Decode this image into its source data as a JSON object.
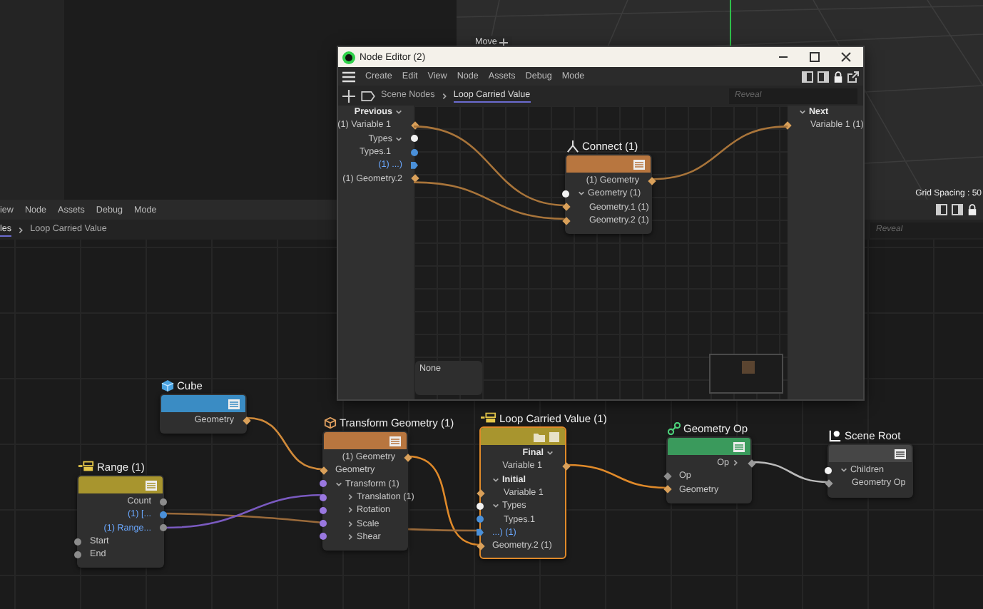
{
  "viewport": {
    "tool_label": "Move",
    "grid_spacing": "Grid Spacing : 50"
  },
  "background_editor": {
    "menu": [
      "iew",
      "Node",
      "Assets",
      "Debug",
      "Mode"
    ],
    "breadcrumb": [
      {
        "label": "les",
        "selected": true
      },
      {
        "label": "Loop Carried Value",
        "selected": false
      }
    ],
    "search": {
      "placeholder": "Reveal"
    }
  },
  "canvas": {
    "nodes": [
      {
        "title": "Cube",
        "color": "#3a8cc4",
        "selected": false,
        "outputs": [
          {
            "kind": "diamond",
            "label": "Geometry",
            "color": "#d9a05a",
            "highlighted": false
          }
        ]
      },
      {
        "title": "Range (1)",
        "color": "#a8952e",
        "selected": false,
        "outputs": [
          {
            "kind": "circle",
            "label": "Count",
            "color": "#8c8c8c",
            "highlighted": false
          },
          {
            "kind": "circle",
            "label": "(1) [...",
            "color": "#4a90d9",
            "highlighted": true
          },
          {
            "kind": "circle",
            "label": "(1) Range...",
            "color": "#8c8c8c",
            "highlighted": true
          }
        ],
        "inputs": [
          {
            "kind": "circle",
            "label": "Start",
            "color": "#8c8c8c",
            "highlighted": false
          },
          {
            "kind": "circle",
            "label": "End",
            "color": "#8c8c8c",
            "highlighted": false
          }
        ]
      },
      {
        "title": "Transform Geometry (1)",
        "color": "#b8763f",
        "selected": false,
        "outputs": [
          {
            "kind": "diamond",
            "label": "(1) Geometry",
            "color": "#d9a05a",
            "highlighted": false
          }
        ],
        "inputs": [
          {
            "kind": "diamond",
            "label": "Geometry",
            "color": "#d9a05a",
            "highlighted": false
          },
          {
            "kind": "circle",
            "label": "Transform (1)",
            "color": "#9a78e0",
            "highlighted": false,
            "expanded": true,
            "children": [
              {
                "kind": "circle",
                "label": "Translation (1)",
                "color": "#9a78e0",
                "highlighted": false,
                "expanded": false
              },
              {
                "kind": "circle",
                "label": "Rotation",
                "color": "#9a78e0",
                "highlighted": false,
                "expanded": false
              },
              {
                "kind": "circle",
                "label": "Scale",
                "color": "#9a78e0",
                "highlighted": false,
                "expanded": false
              },
              {
                "kind": "circle",
                "label": "Shear",
                "color": "#9a78e0",
                "highlighted": false,
                "expanded": false
              }
            ]
          }
        ]
      },
      {
        "title": "Loop Carried Value (1)",
        "color": "#a8952e",
        "selected": true,
        "outputs": [
          {
            "kind": "group",
            "label": "Final",
            "expanded": true,
            "children": [
              {
                "kind": "diamond",
                "label": "Variable 1",
                "color": "#d9a05a",
                "highlighted": false
              }
            ]
          }
        ],
        "inputs": [
          {
            "kind": "group",
            "label": "Initial",
            "expanded": true,
            "children": [
              {
                "kind": "diamond",
                "label": "Variable 1",
                "color": "#d9a05a",
                "highlighted": false
              }
            ]
          },
          {
            "kind": "circle",
            "label": "Types",
            "color": "#f2f2f2",
            "highlighted": false,
            "expanded": true,
            "children": [
              {
                "kind": "circle",
                "label": "Types.1",
                "color": "#4a90d9",
                "highlighted": false
              }
            ]
          },
          {
            "kind": "arrow",
            "label": "...) (1)",
            "color": "#4a90d9",
            "highlighted": true
          },
          {
            "kind": "diamond",
            "label": "Geometry.2 (1)",
            "color": "#d9a05a",
            "highlighted": false
          }
        ]
      },
      {
        "title": "Geometry Op",
        "color": "#3a9a5c",
        "selected": false,
        "outputs": [
          {
            "kind": "diamond",
            "label": "Op",
            "color": "#9a9a9a",
            "highlighted": false,
            "expanded": false
          }
        ],
        "inputs": [
          {
            "kind": "diamond",
            "label": "Op",
            "color": "#8c8c8c",
            "highlighted": false
          },
          {
            "kind": "diamond",
            "label": "Geometry",
            "color": "#d9a05a",
            "highlighted": false
          }
        ]
      },
      {
        "title": "Scene Root",
        "color": "#464646",
        "selected": false,
        "inputs": [
          {
            "kind": "circle",
            "label": "Children",
            "color": "#f2f2f2",
            "highlighted": false,
            "expanded": true,
            "children": [
              {
                "kind": "diamond",
                "label": "Geometry Op",
                "color": "#9a9a9a",
                "highlighted": false
              }
            ]
          }
        ]
      }
    ]
  },
  "node_editor_window": {
    "title": "Node Editor (2)",
    "menu": [
      "Create",
      "Edit",
      "View",
      "Node",
      "Assets",
      "Debug",
      "Mode"
    ],
    "breadcrumb": [
      {
        "label": "Scene Nodes",
        "selected": false
      },
      {
        "label": "Loop Carried Value",
        "selected": true
      }
    ],
    "search": {
      "placeholder": "Reveal"
    },
    "previous_panel": {
      "outputs": [
        {
          "kind": "group",
          "label": "Previous",
          "expanded": true,
          "children": [
            {
              "kind": "diamond",
              "label": "(1) Variable 1",
              "color": "#d9a05a",
              "highlighted": false
            }
          ]
        },
        {
          "kind": "circle",
          "label": "Types",
          "color": "#f2f2f2",
          "highlighted": false,
          "expanded": true,
          "children": [
            {
              "kind": "circle",
              "label": "Types.1",
              "color": "#4a90d9",
              "highlighted": false
            }
          ]
        },
        {
          "kind": "arrow",
          "label": "(1) ...)",
          "color": "#4a90d9",
          "highlighted": true
        },
        {
          "kind": "diamond",
          "label": "(1) Geometry.2",
          "color": "#d9a05a",
          "highlighted": false
        }
      ]
    },
    "next_panel": {
      "inputs": [
        {
          "kind": "group",
          "label": "Next",
          "expanded": true,
          "children": [
            {
              "kind": "diamond",
              "label": "Variable 1 (1)",
              "color": "#d9a05a",
              "highlighted": false
            }
          ]
        }
      ]
    },
    "nodes": [
      {
        "title": "Connect (1)",
        "color": "#b8763f",
        "selected": false,
        "outputs": [
          {
            "kind": "diamond",
            "label": "(1) Geometry",
            "color": "#d9a05a",
            "highlighted": false
          }
        ],
        "inputs": [
          {
            "kind": "circle",
            "label": "Geometry (1)",
            "color": "#f2f2f2",
            "highlighted": false,
            "expanded": true,
            "children": [
              {
                "kind": "diamond",
                "label": "Geometry.1 (1)",
                "color": "#d9a05a",
                "highlighted": false
              },
              {
                "kind": "diamond",
                "label": "Geometry.2 (1)",
                "color": "#d9a05a",
                "highlighted": false
              }
            ]
          }
        ]
      }
    ],
    "info_box": "None"
  }
}
